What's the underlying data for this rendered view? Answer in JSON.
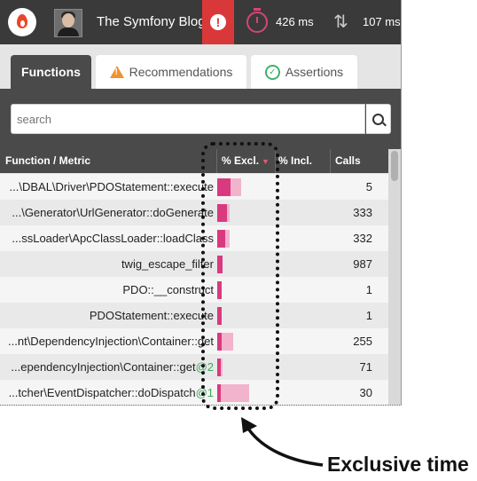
{
  "header": {
    "app_title": "The Symfony Blog",
    "time_metric": "426 ms",
    "calls_metric": "107 ms"
  },
  "tabs": [
    {
      "label": "Functions",
      "active": true
    },
    {
      "label": "Recommendations",
      "icon": "warning-icon"
    },
    {
      "label": "Assertions",
      "icon": "check-circle-icon"
    }
  ],
  "search": {
    "placeholder": "search",
    "value": ""
  },
  "table": {
    "columns": [
      "Function / Metric",
      "% Excl.",
      "% Incl.",
      "Calls"
    ],
    "sorted_by": "% Excl.",
    "rows": [
      {
        "name": "...\\DBAL\\Driver\\PDOStatement::execute",
        "suffix": "",
        "calls": "5",
        "excl": 0.25,
        "incl": 0.45
      },
      {
        "name": "...\\Generator\\UrlGenerator::doGenerate",
        "suffix": "",
        "calls": "333",
        "excl": 0.18,
        "incl": 0.24
      },
      {
        "name": "...ssLoader\\ApcClassLoader::loadClass",
        "suffix": "",
        "calls": "332",
        "excl": 0.15,
        "incl": 0.24
      },
      {
        "name": "twig_escape_filter",
        "suffix": "",
        "calls": "987",
        "excl": 0.1,
        "incl": 0.1
      },
      {
        "name": "PDO::__construct",
        "suffix": "",
        "calls": "1",
        "excl": 0.08,
        "incl": 0.08
      },
      {
        "name": "PDOStatement::execute",
        "suffix": "",
        "calls": "1",
        "excl": 0.08,
        "incl": 0.08
      },
      {
        "name": "...nt\\DependencyInjection\\Container::get",
        "suffix": "",
        "calls": "255",
        "excl": 0.08,
        "incl": 0.3
      },
      {
        "name": "...ependencyInjection\\Container::get",
        "suffix": "@2",
        "calls": "71",
        "excl": 0.07,
        "incl": 0.1
      },
      {
        "name": "...tcher\\EventDispatcher::doDispatch",
        "suffix": "@1",
        "calls": "30",
        "excl": 0.07,
        "incl": 0.6
      }
    ]
  },
  "annotation": {
    "label": "Exclusive time"
  },
  "colors": {
    "accent": "#d93a7f",
    "accent_light": "#f2b4cd",
    "alert": "#d9383a",
    "topbar": "#3a3a3a"
  }
}
